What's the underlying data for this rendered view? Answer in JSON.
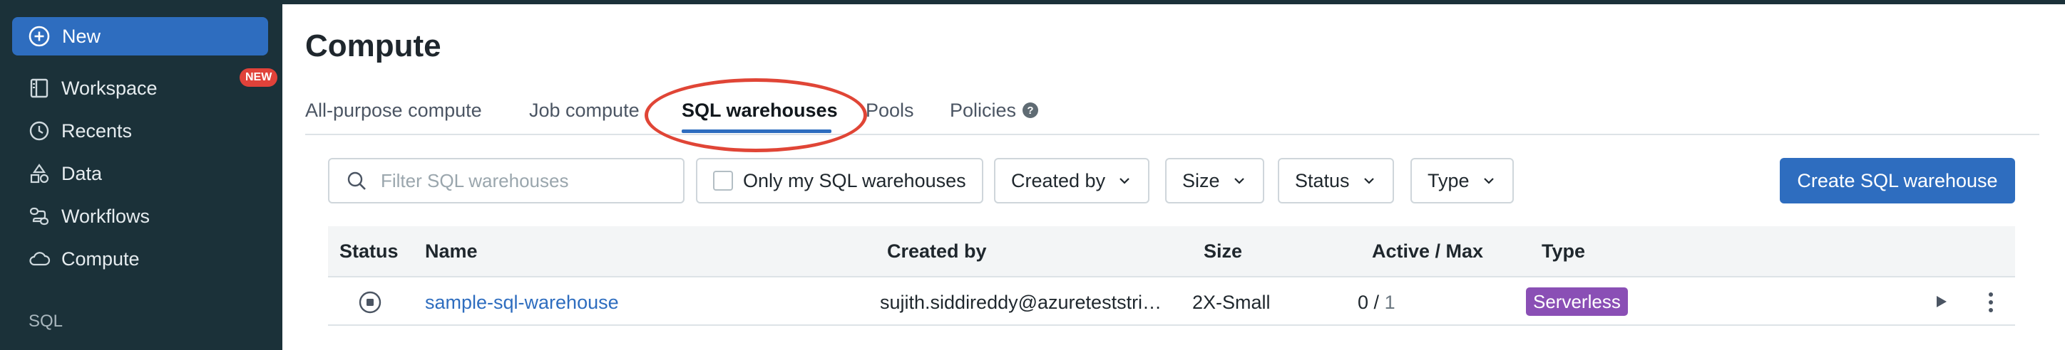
{
  "sidebar": {
    "new_label": "New",
    "new_badge": "NEW",
    "items": [
      {
        "label": "Workspace",
        "icon": "workspace-icon"
      },
      {
        "label": "Recents",
        "icon": "clock-icon"
      },
      {
        "label": "Data",
        "icon": "data-icon"
      },
      {
        "label": "Workflows",
        "icon": "workflows-icon"
      },
      {
        "label": "Compute",
        "icon": "cloud-icon"
      }
    ],
    "section_label": "SQL"
  },
  "page": {
    "title": "Compute"
  },
  "tabs": [
    {
      "label": "All-purpose compute"
    },
    {
      "label": "Job compute"
    },
    {
      "label": "SQL warehouses",
      "active": true
    },
    {
      "label": "Pools"
    },
    {
      "label": "Policies"
    }
  ],
  "toolbar": {
    "search_placeholder": "Filter SQL warehouses",
    "only_mine_label": "Only my SQL warehouses",
    "filters": [
      "Created by",
      "Size",
      "Status",
      "Type"
    ],
    "create_label": "Create SQL warehouse"
  },
  "table": {
    "columns": [
      "Status",
      "Name",
      "Created by",
      "Size",
      "Active / Max",
      "Type"
    ],
    "rows": [
      {
        "name": "sample-sql-warehouse",
        "created_by": "sujith.siddireddy@azureteststri…",
        "size": "2X-Small",
        "active": "0",
        "separator": "/",
        "max": "1",
        "type": "Serverless"
      }
    ]
  },
  "colors": {
    "sidebar": "#1b3139",
    "primary": "#2e6dbf",
    "serverless_badge": "#8a4fb5",
    "annotation": "#e04536",
    "new_badge": "#e0423a"
  }
}
